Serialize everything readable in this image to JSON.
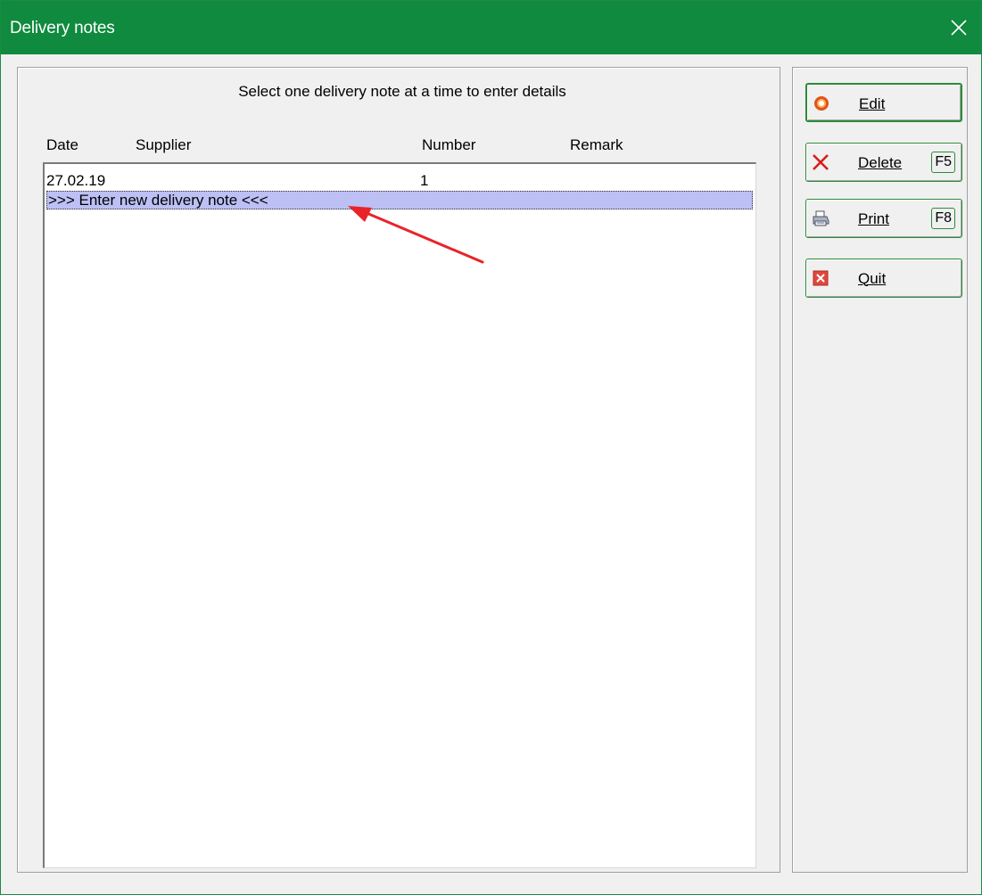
{
  "window": {
    "title": "Delivery notes",
    "close_label": "Close"
  },
  "instruction": "Select one delivery note at a time to enter details",
  "columns": {
    "date": "Date",
    "supplier": "Supplier",
    "number": "Number",
    "remark": "Remark"
  },
  "rows": [
    {
      "date": "27.02.19",
      "supplier": "",
      "number": "1",
      "remark": ""
    }
  ],
  "new_entry_label": ">>> Enter new delivery note <<<",
  "buttons": {
    "edit": {
      "label": "Edit",
      "icon": "edit-ring-icon"
    },
    "delete": {
      "label": "Delete",
      "key": "F5",
      "icon": "red-x-icon"
    },
    "print": {
      "label": "Print",
      "key": "F8",
      "icon": "printer-icon"
    },
    "quit": {
      "label": "Quit",
      "icon": "quit-icon"
    }
  },
  "colors": {
    "titlebar": "#0f8a3e",
    "selection": "#bcc0f4",
    "annotation_arrow": "#e8242a"
  }
}
